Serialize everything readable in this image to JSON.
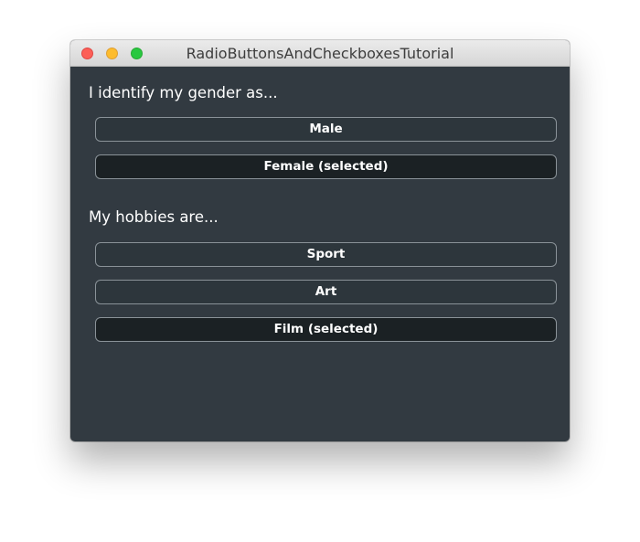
{
  "window": {
    "title": "RadioButtonsAndCheckboxesTutorial"
  },
  "gender": {
    "heading": "I identify my gender as...",
    "options": [
      {
        "label": "Male",
        "selected": false
      },
      {
        "label": "Female (selected)",
        "selected": true
      }
    ]
  },
  "hobbies": {
    "heading": "My hobbies are...",
    "options": [
      {
        "label": "Sport",
        "selected": false
      },
      {
        "label": "Art",
        "selected": false
      },
      {
        "label": "Film (selected)",
        "selected": true
      }
    ]
  },
  "colors": {
    "window_background": "#323a41",
    "option_background": "#2d363c",
    "selected_option_background": "#1b2124",
    "option_border": "#8a9298",
    "text": "#ffffff",
    "close_button": "#fc5f57",
    "minimize_button": "#fdbc2e",
    "zoom_button": "#28c840"
  }
}
